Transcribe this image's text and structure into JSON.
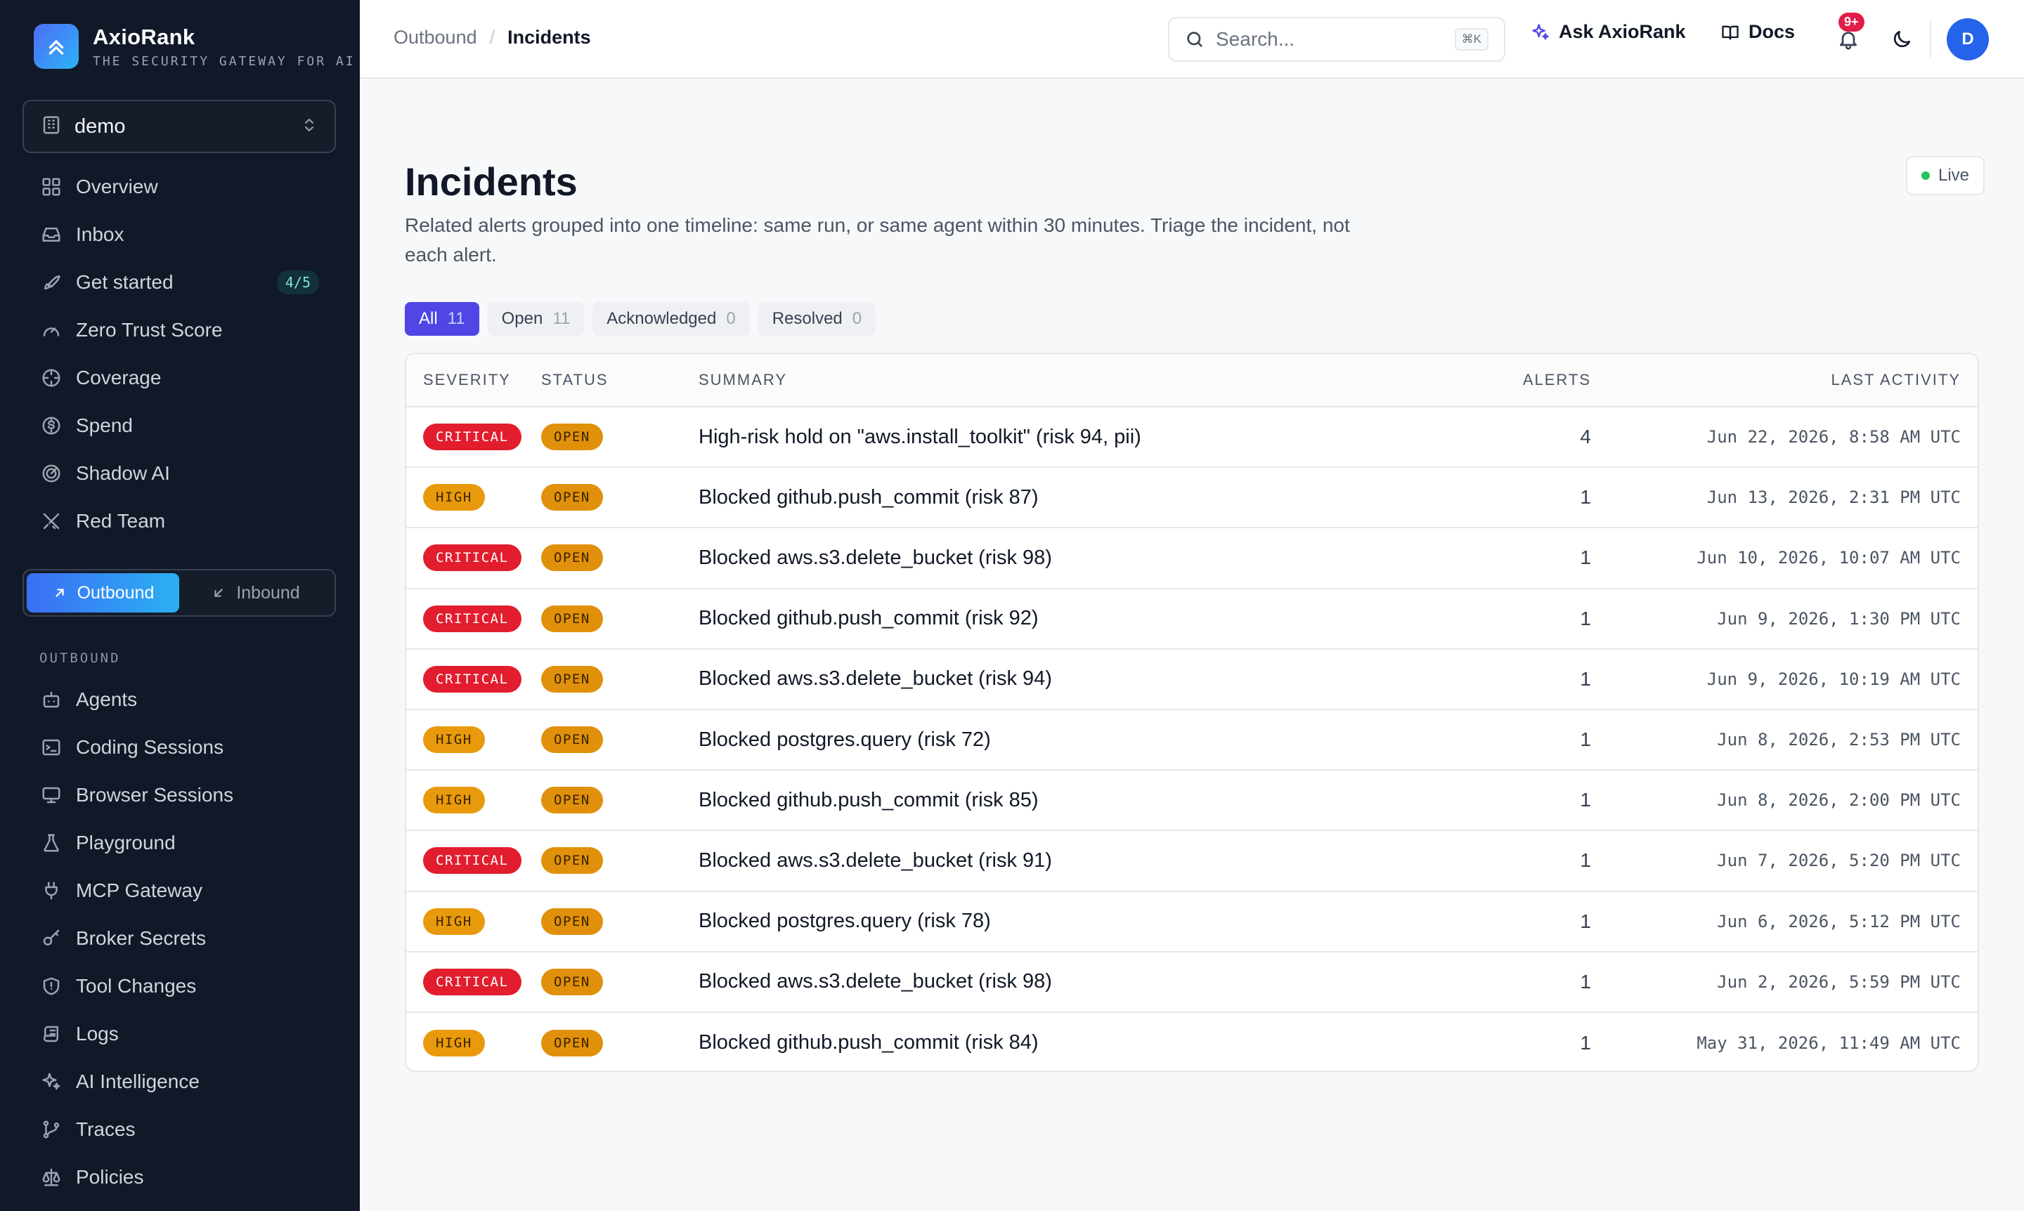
{
  "brand": {
    "name": "AxioRank",
    "tagline": "THE SECURITY GATEWAY FOR AI AG"
  },
  "org": {
    "name": "demo"
  },
  "nav_primary": [
    {
      "label": "Overview",
      "icon": "grid-icon"
    },
    {
      "label": "Inbox",
      "icon": "inbox-icon"
    },
    {
      "label": "Get started",
      "icon": "rocket-icon",
      "badge": "4/5"
    },
    {
      "label": "Zero Trust Score",
      "icon": "gauge-icon"
    },
    {
      "label": "Coverage",
      "icon": "crosshair-icon"
    },
    {
      "label": "Spend",
      "icon": "dollar-icon"
    },
    {
      "label": "Shadow AI",
      "icon": "radar-icon"
    },
    {
      "label": "Red Team",
      "icon": "swords-icon"
    }
  ],
  "direction": {
    "outbound": "Outbound",
    "inbound": "Inbound",
    "active": "outbound"
  },
  "section_label": "OUTBOUND",
  "nav_outbound": [
    {
      "label": "Agents",
      "icon": "bot-icon"
    },
    {
      "label": "Coding Sessions",
      "icon": "terminal-icon"
    },
    {
      "label": "Browser Sessions",
      "icon": "monitor-icon"
    },
    {
      "label": "Playground",
      "icon": "flask-icon"
    },
    {
      "label": "MCP Gateway",
      "icon": "plug-icon"
    },
    {
      "label": "Broker Secrets",
      "icon": "key-icon"
    },
    {
      "label": "Tool Changes",
      "icon": "shield-icon"
    },
    {
      "label": "Logs",
      "icon": "scroll-icon"
    },
    {
      "label": "AI Intelligence",
      "icon": "sparkles-icon"
    },
    {
      "label": "Traces",
      "icon": "git-branch-icon"
    },
    {
      "label": "Policies",
      "icon": "scale-icon"
    }
  ],
  "header": {
    "breadcrumb_parent": "Outbound",
    "breadcrumb_current": "Incidents",
    "search_placeholder": "Search...",
    "search_shortcut": "⌘K",
    "ask_label": "Ask AxioRank",
    "docs_label": "Docs",
    "notifications_badge": "9+",
    "avatar_initial": "D"
  },
  "page": {
    "title": "Incidents",
    "description": "Related alerts grouped into one timeline: same run, or same agent within 30 minutes. Triage the incident, not each alert.",
    "live_label": "Live"
  },
  "filters": [
    {
      "label": "All",
      "count": "11",
      "active": true
    },
    {
      "label": "Open",
      "count": "11",
      "active": false
    },
    {
      "label": "Acknowledged",
      "count": "0",
      "active": false
    },
    {
      "label": "Resolved",
      "count": "0",
      "active": false
    }
  ],
  "table": {
    "columns": {
      "severity": "SEVERITY",
      "status": "STATUS",
      "summary": "SUMMARY",
      "alerts": "ALERTS",
      "last_activity": "LAST ACTIVITY"
    },
    "rows": [
      {
        "severity": "CRITICAL",
        "status": "OPEN",
        "summary": "High-risk hold on \"aws.install_toolkit\" (risk 94, pii)",
        "alerts": "4",
        "last_activity": "Jun 22, 2026, 8:58 AM UTC"
      },
      {
        "severity": "HIGH",
        "status": "OPEN",
        "summary": "Blocked github.push_commit (risk 87)",
        "alerts": "1",
        "last_activity": "Jun 13, 2026, 2:31 PM UTC"
      },
      {
        "severity": "CRITICAL",
        "status": "OPEN",
        "summary": "Blocked aws.s3.delete_bucket (risk 98)",
        "alerts": "1",
        "last_activity": "Jun 10, 2026, 10:07 AM UTC"
      },
      {
        "severity": "CRITICAL",
        "status": "OPEN",
        "summary": "Blocked github.push_commit (risk 92)",
        "alerts": "1",
        "last_activity": "Jun 9, 2026, 1:30 PM UTC"
      },
      {
        "severity": "CRITICAL",
        "status": "OPEN",
        "summary": "Blocked aws.s3.delete_bucket (risk 94)",
        "alerts": "1",
        "last_activity": "Jun 9, 2026, 10:19 AM UTC"
      },
      {
        "severity": "HIGH",
        "status": "OPEN",
        "summary": "Blocked postgres.query (risk 72)",
        "alerts": "1",
        "last_activity": "Jun 8, 2026, 2:53 PM UTC"
      },
      {
        "severity": "HIGH",
        "status": "OPEN",
        "summary": "Blocked github.push_commit (risk 85)",
        "alerts": "1",
        "last_activity": "Jun 8, 2026, 2:00 PM UTC"
      },
      {
        "severity": "CRITICAL",
        "status": "OPEN",
        "summary": "Blocked aws.s3.delete_bucket (risk 91)",
        "alerts": "1",
        "last_activity": "Jun 7, 2026, 5:20 PM UTC"
      },
      {
        "severity": "HIGH",
        "status": "OPEN",
        "summary": "Blocked postgres.query (risk 78)",
        "alerts": "1",
        "last_activity": "Jun 6, 2026, 5:12 PM UTC"
      },
      {
        "severity": "CRITICAL",
        "status": "OPEN",
        "summary": "Blocked aws.s3.delete_bucket (risk 98)",
        "alerts": "1",
        "last_activity": "Jun 2, 2026, 5:59 PM UTC"
      },
      {
        "severity": "HIGH",
        "status": "OPEN",
        "summary": "Blocked github.push_commit (risk 84)",
        "alerts": "1",
        "last_activity": "May 31, 2026, 11:49 AM UTC"
      }
    ]
  }
}
